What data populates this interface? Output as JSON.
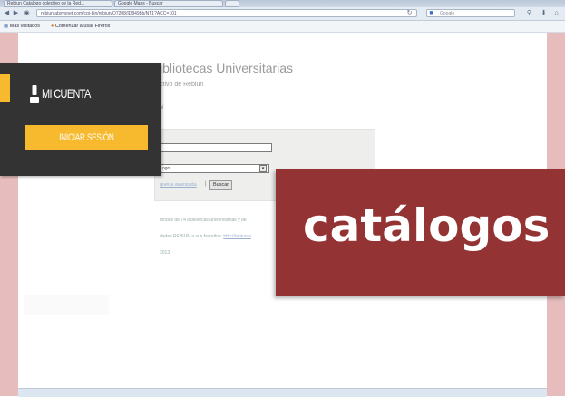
{
  "browser": {
    "tabs": [
      "Rebiun Catalogo colectivo de la Red...",
      "Google Maps - Buscar",
      "REBIUN"
    ],
    "url": "rebiun.absysnet.com/cgi-bin/rebiun/O7208/ID8498b/NT1?ACC=101",
    "search_placeholder": "Google",
    "bookmarks": [
      "Más visitados",
      "Comenzar a usar Firefox"
    ],
    "icons": [
      "back-icon",
      "forward-icon",
      "reload-icon",
      "home-icon",
      "download-icon",
      "search-icon"
    ]
  },
  "page": {
    "title_partial": "ibliotecas Universitarias",
    "subtitle_partial": "ctivo de Rebiun",
    "language_partial": "ol",
    "catalog_option_partial": "ogo",
    "advanced_search_partial": "queda avanzada",
    "search_button": "Buscar",
    "info_lines": [
      "fondos de 74 bibliotecas universitarias y de",
      "dades REBIUN a sus favoritos:",
      "2013"
    ],
    "info_link": "http://rebiun.a"
  },
  "account_panel": {
    "label": "MI CUENTA",
    "login_button": "INICIAR SESIÓN"
  },
  "callout": {
    "text": "catálogos"
  },
  "colors": {
    "accent_yellow": "#f7b92e",
    "panel_dark": "#333333",
    "callout_red": "#943333",
    "pink_band": "#e6bcbc"
  }
}
